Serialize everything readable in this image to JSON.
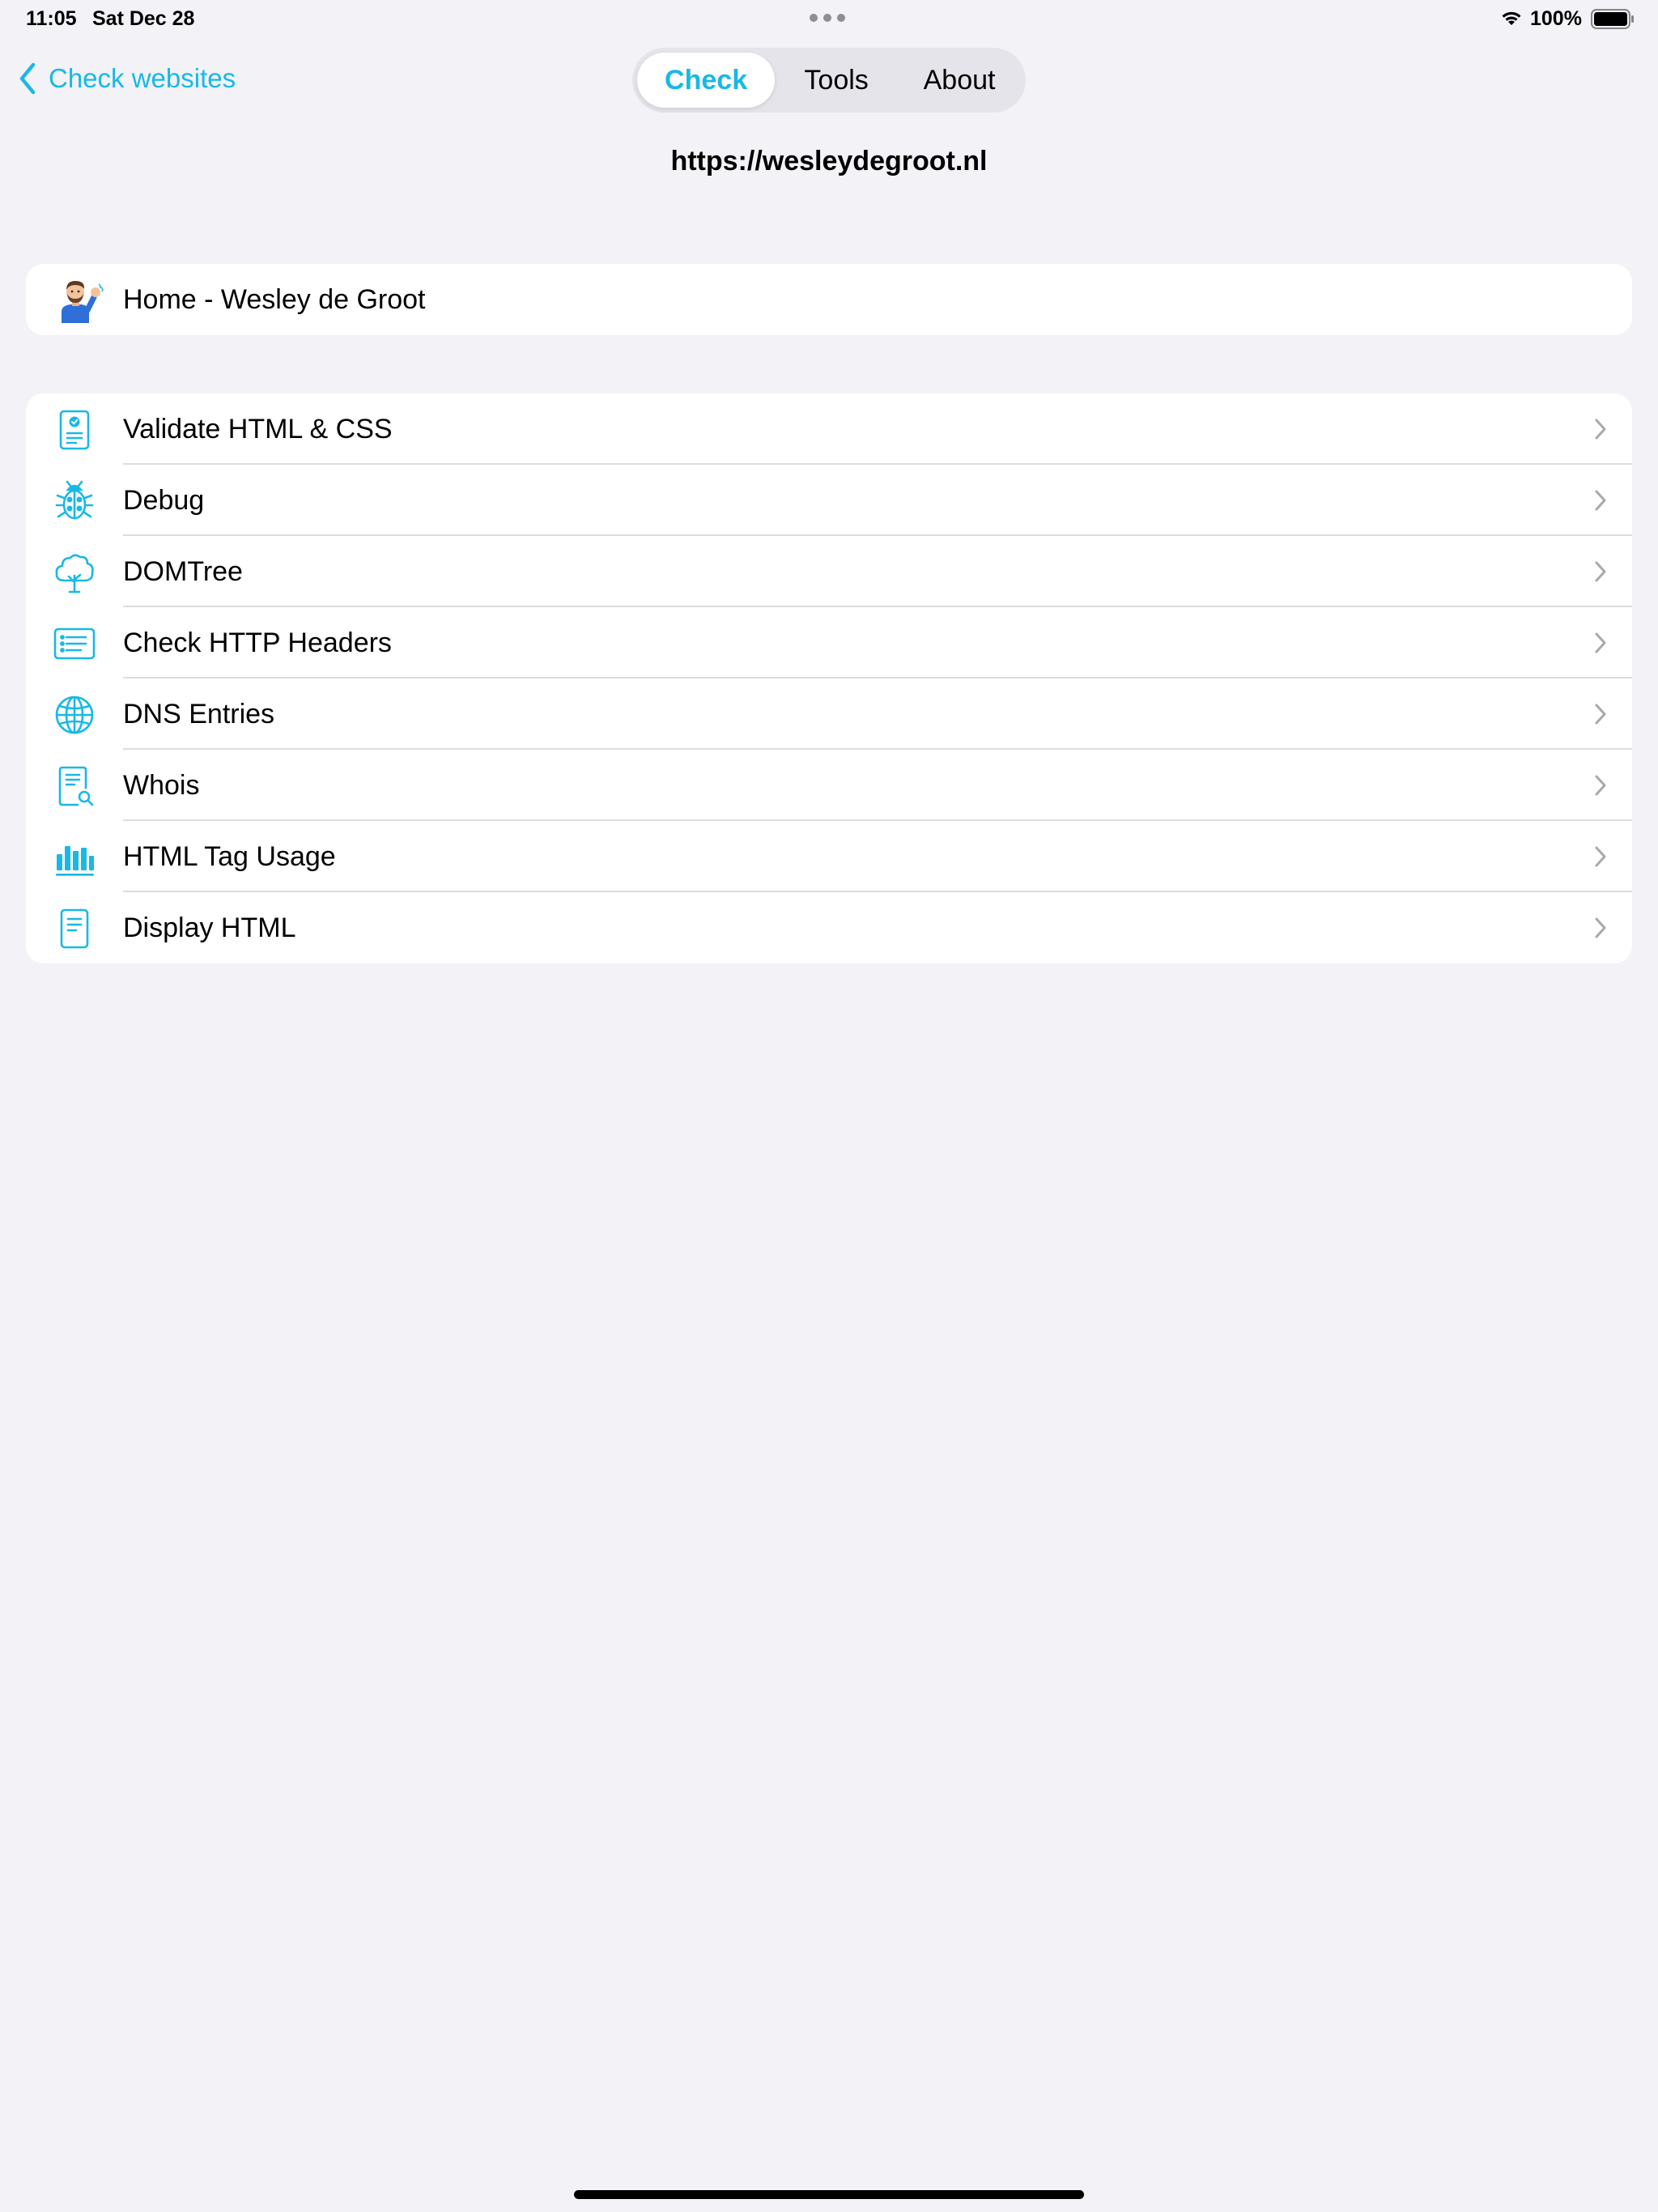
{
  "status_bar": {
    "time": "11:05",
    "date": "Sat Dec 28",
    "battery": "100%"
  },
  "nav": {
    "back_label": "Check websites",
    "tabs": [
      {
        "label": "Check",
        "active": true
      },
      {
        "label": "Tools",
        "active": false
      },
      {
        "label": "About",
        "active": false
      }
    ]
  },
  "url": "https://wesleydegroot.nl",
  "page": {
    "title": "Home - Wesley de Groot",
    "avatar_icon": "memoji-waving-avatar"
  },
  "actions": [
    {
      "label": "Validate HTML & CSS",
      "icon": "validate-document-icon"
    },
    {
      "label": "Debug",
      "icon": "ladybug-icon"
    },
    {
      "label": "DOMTree",
      "icon": "tree-icon"
    },
    {
      "label": "Check HTTP Headers",
      "icon": "list-window-icon"
    },
    {
      "label": "DNS Entries",
      "icon": "globe-icon"
    },
    {
      "label": "Whois",
      "icon": "document-search-icon"
    },
    {
      "label": "HTML Tag Usage",
      "icon": "bar-chart-icon"
    },
    {
      "label": "Display HTML",
      "icon": "document-text-icon"
    }
  ],
  "colors": {
    "accent": "#19B8E6",
    "background": "#F2F2F7",
    "card": "#FFFFFF",
    "separator": "#DCDCE0",
    "chevron": "#A8A8AD"
  }
}
